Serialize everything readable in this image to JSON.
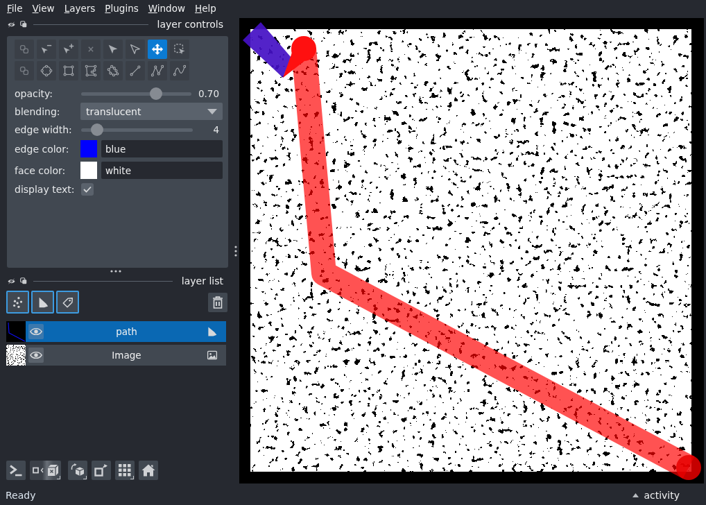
{
  "menu_bar": [
    {
      "label": "File"
    },
    {
      "label": "View"
    },
    {
      "label": "Layers"
    },
    {
      "label": "Plugins"
    },
    {
      "label": "Window"
    },
    {
      "label": "Help"
    }
  ],
  "layer_controls": {
    "title": "layer controls",
    "tools": [
      {
        "kind": "move-front",
        "selected": false,
        "disabled": true
      },
      {
        "kind": "vertex-remove",
        "selected": false,
        "disabled": false
      },
      {
        "kind": "vertex-insert",
        "selected": false,
        "disabled": false
      },
      {
        "kind": "delete",
        "selected": false,
        "disabled": true
      },
      {
        "kind": "select",
        "selected": false,
        "disabled": false
      },
      {
        "kind": "direct",
        "selected": false,
        "disabled": false
      },
      {
        "kind": "pan-zoom",
        "selected": true,
        "disabled": false
      },
      {
        "kind": "transform",
        "selected": false,
        "disabled": false
      },
      {
        "kind": "move-back",
        "selected": false,
        "disabled": true
      },
      {
        "kind": "ellipse",
        "selected": false,
        "disabled": false
      },
      {
        "kind": "rectangle",
        "selected": false,
        "disabled": false
      },
      {
        "kind": "polygon",
        "selected": false,
        "disabled": false
      },
      {
        "kind": "lasso",
        "selected": false,
        "disabled": false
      },
      {
        "kind": "line",
        "selected": false,
        "disabled": false
      },
      {
        "kind": "path",
        "selected": false,
        "disabled": false
      },
      {
        "kind": "polyline",
        "selected": false,
        "disabled": false
      }
    ],
    "opacity": {
      "label": "opacity:",
      "level": 0.7,
      "reading": "0.70"
    },
    "blending": {
      "label": "blending:",
      "value": "translucent"
    },
    "edge_width": {
      "label": "edge width:",
      "level": 0.1,
      "reading": "4"
    },
    "edge_color": {
      "label": "edge color:",
      "color": "#0000ff",
      "value": "blue"
    },
    "face_color": {
      "label": "face color:",
      "color": "#ffffff",
      "value": "white"
    },
    "display_text": {
      "label": "display text:",
      "checked": true
    }
  },
  "layer_list": {
    "title": "layer list",
    "new_layer_buttons": [
      {
        "kind": "points"
      },
      {
        "kind": "shapes"
      },
      {
        "kind": "labels"
      }
    ],
    "layers": [
      {
        "name": "path",
        "kind": "shapes",
        "selected": true,
        "visible": true
      },
      {
        "name": "Image",
        "kind": "image",
        "selected": false,
        "visible": true
      }
    ]
  },
  "viewer_buttons": [
    {
      "kind": "console"
    },
    {
      "kind": "ndisplay"
    },
    {
      "kind": "roll"
    },
    {
      "kind": "transpose"
    },
    {
      "kind": "grid"
    },
    {
      "kind": "home"
    }
  ],
  "status_bar": {
    "message": "Ready",
    "activity": "activity"
  }
}
